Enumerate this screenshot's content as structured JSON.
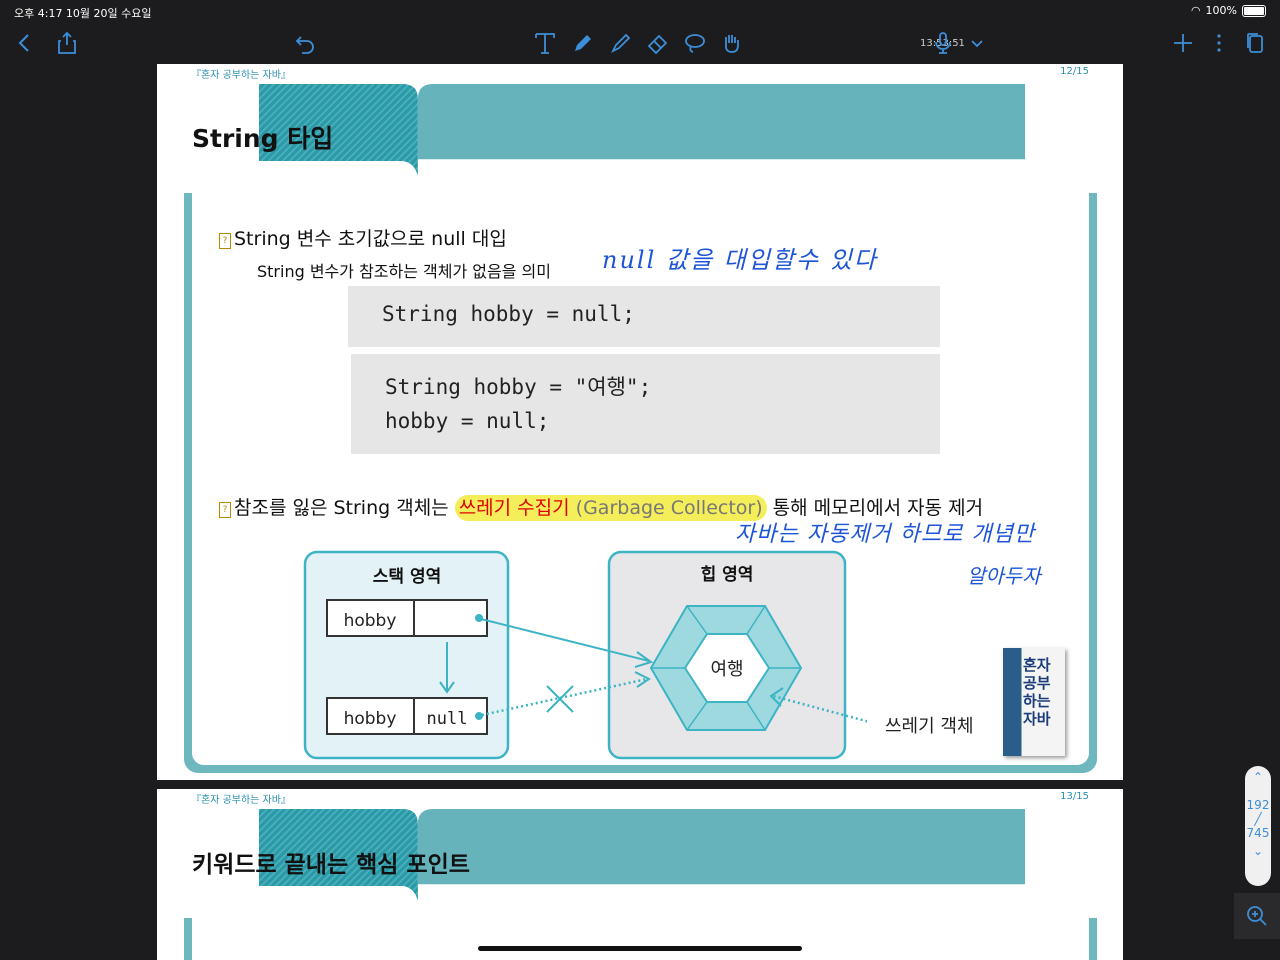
{
  "status": {
    "time_date": "오후 4:17  10월 20일 수요일",
    "battery": "100%"
  },
  "toolbar": {
    "clock": "13:53:51",
    "icons": [
      "back-icon",
      "share-icon",
      "undo-icon",
      "text-tool-icon",
      "pen-tool-icon",
      "highlighter-icon",
      "eraser-icon",
      "lasso-icon",
      "hand-icon",
      "mic-icon",
      "chevron-down-icon",
      "add-icon",
      "more-icon",
      "pages-icon"
    ]
  },
  "page1": {
    "book": "『혼자 공부하는 자바』",
    "page_num": "12/15",
    "title": "String 타입",
    "bullet1": "String 변수 초기값으로 null 대입",
    "bullet1_sub": "String 변수가 참조하는 객체가 없음을 의미",
    "code1": "String hobby = null;",
    "code2_line1": "String hobby = \"여행\";",
    "code2_line2": "hobby = null;",
    "bullet2_pre": "참조를 잃은 String 객체는 ",
    "bullet2_hl": "쓰레기 수집기",
    "bullet2_gc": " (Garbage Collector)",
    "bullet2_post": " 통해 메모리에서 자동 제거",
    "diagram": {
      "stack_title": "스택 영역",
      "heap_title": "힙 영역",
      "var1": "hobby",
      "var2": "hobby",
      "null_val": "null",
      "object": "여행",
      "garbage_label": "쓰레기 객체"
    },
    "handwriting": {
      "note1": "null 값을 대입할수 있다",
      "note2": "자바는 자동제거 하므로 개념만",
      "note3": "알아두자"
    },
    "book_cover": {
      "title": "혼자 공부하는 자바"
    }
  },
  "page2": {
    "book": "『혼자 공부하는 자바』",
    "page_num": "13/15",
    "title": "키워드로 끝내는 핵심 포인트"
  },
  "scroll": {
    "current": "192",
    "total": "745"
  },
  "colors": {
    "teal": "#6fb7bf",
    "teal_dark": "#2a9aa8",
    "ink": "#1e55d8",
    "accent": "#3d8ed8"
  }
}
